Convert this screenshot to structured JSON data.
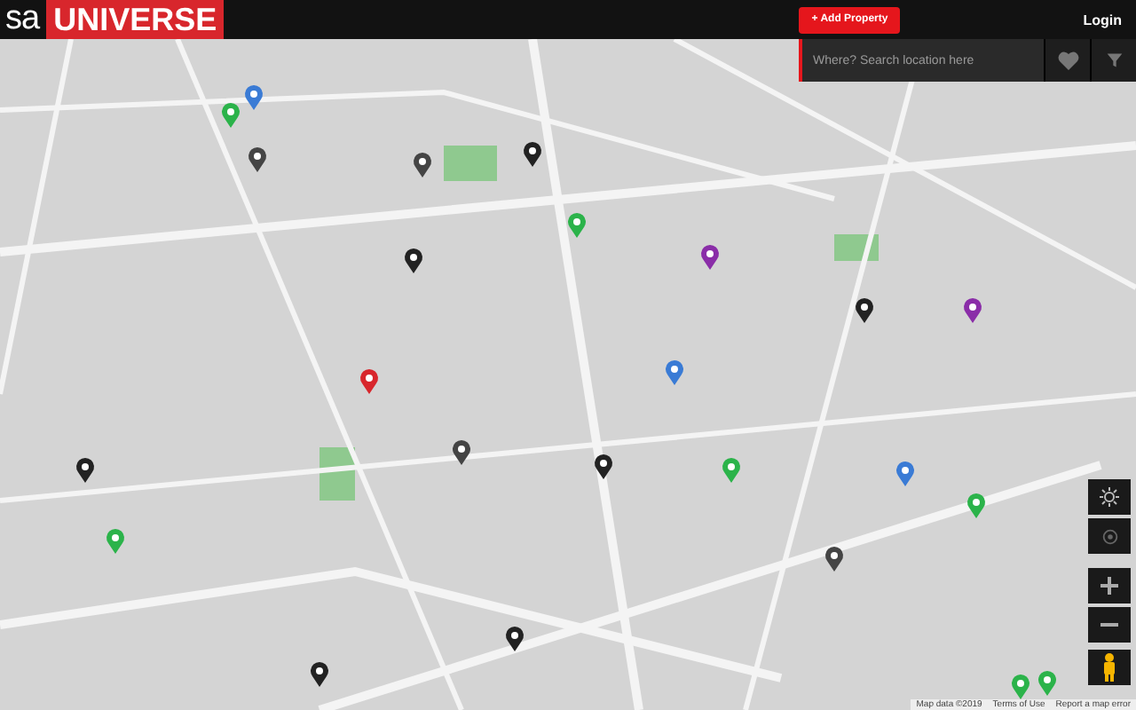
{
  "header": {
    "logo_prefix": "sa",
    "logo_name": "UNIVERSE",
    "add_button": "+ Add Property",
    "login": "Login"
  },
  "search": {
    "placeholder": "Where? Search location here"
  },
  "map_footer": [
    "Map data ©2019",
    "Terms of Use",
    "Report a map error"
  ]
}
